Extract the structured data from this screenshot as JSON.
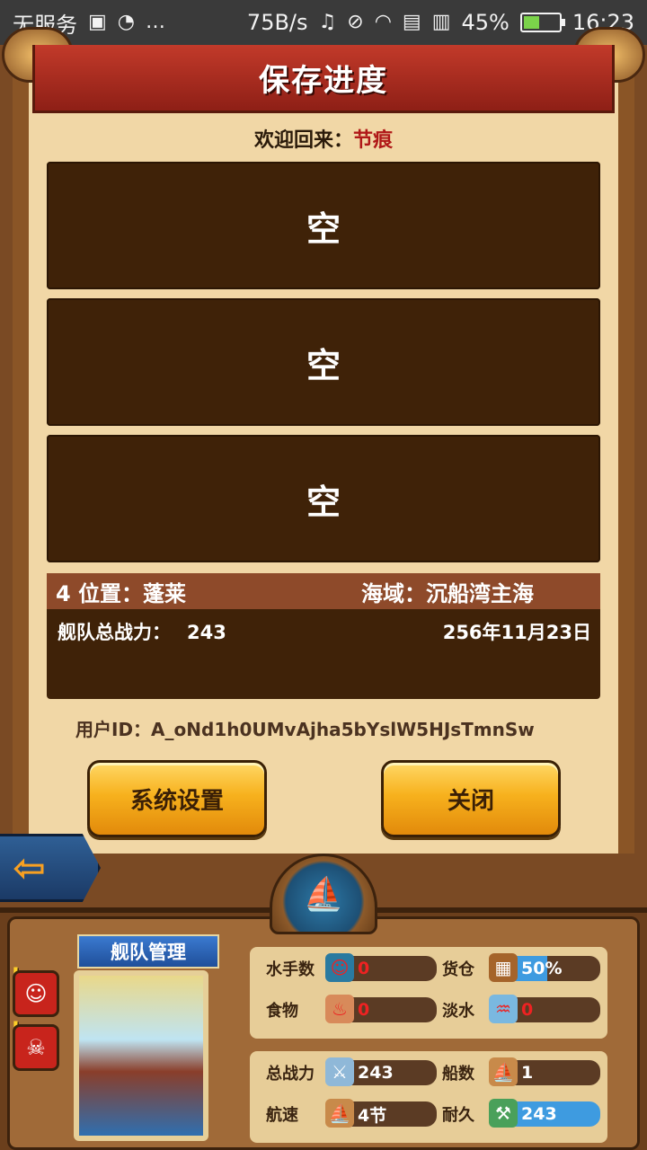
{
  "status_bar": {
    "carrier": "无服务",
    "speed": "75B/s",
    "battery": "45%",
    "battery_level": 0.45,
    "time": "16:23"
  },
  "title": "保存进度",
  "welcome": {
    "label": "欢迎回来：",
    "name": "节痕"
  },
  "slots": [
    {
      "label": "空"
    },
    {
      "label": "空"
    },
    {
      "label": "空"
    }
  ],
  "slot4": {
    "number": "4",
    "location": "位置：蓬莱",
    "sea": "海域：沉船湾主海",
    "power_label": "舰队总战力：",
    "power_value": "243",
    "date": "256年11月23日"
  },
  "user_id": "用户ID：A_oNd1h0UMvAjha5bYslW5HJsTmnSw",
  "buttons": {
    "settings": "系统设置",
    "close": "关闭"
  },
  "hud": {
    "fleet_tag": "舰队管理",
    "stats": {
      "sailors": {
        "label": "水手数",
        "value": "0"
      },
      "cargo": {
        "label": "货仓",
        "value": "50%"
      },
      "food": {
        "label": "食物",
        "value": "0"
      },
      "water": {
        "label": "淡水",
        "value": "0"
      },
      "total_power": {
        "label": "总战力",
        "value": "243"
      },
      "ships": {
        "label": "船数",
        "value": "1"
      },
      "speed": {
        "label": "航速",
        "value": "4节"
      },
      "durability": {
        "label": "耐久",
        "value": "243"
      }
    }
  }
}
